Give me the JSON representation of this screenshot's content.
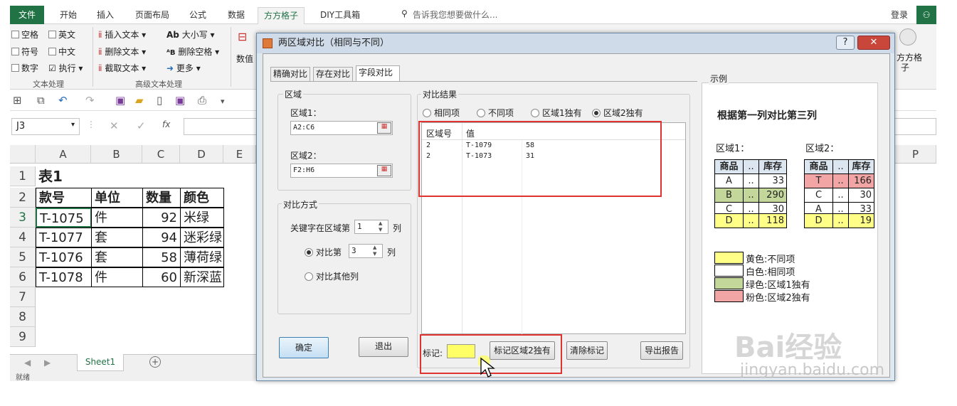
{
  "ribbon": {
    "tabs": [
      "文件",
      "开始",
      "插入",
      "页面布局",
      "公式",
      "数据",
      "方方格子",
      "DIY工具箱"
    ],
    "active_tab": "方方格子",
    "tell_me": "告诉我您想要做什么...",
    "login": "登录",
    "left_checks": [
      "空格",
      "英文",
      "符号",
      "中文",
      "数字"
    ],
    "exec": "执行",
    "text_tools": [
      "插入文本",
      "删除文本",
      "截取文本"
    ],
    "adv_tools": [
      "大小写",
      "删除空格",
      "更多"
    ],
    "group_text": "文本处理",
    "group_adv": "高级文本处理",
    "num_label": "数值",
    "fangge": "方方格",
    "zi": "子"
  },
  "formula": {
    "namebox": "J3",
    "fx": "fx"
  },
  "grid": {
    "columns": [
      "A",
      "B",
      "C",
      "D",
      "E"
    ],
    "col_p": "P",
    "rows": [
      "1",
      "2",
      "3",
      "4",
      "5",
      "6",
      "7",
      "8",
      "9"
    ],
    "title": "表1",
    "headers": [
      "款号",
      "单位",
      "数量",
      "颜色"
    ],
    "data": [
      [
        "T-1075",
        "件",
        "92",
        "米绿"
      ],
      [
        "T-1077",
        "套",
        "94",
        "迷彩绿"
      ],
      [
        "T-1076",
        "套",
        "58",
        "薄荷绿"
      ],
      [
        "T-1078",
        "件",
        "60",
        "新深蓝"
      ]
    ]
  },
  "sheet": {
    "tab": "Sheet1",
    "status": "就绪"
  },
  "dialog": {
    "title": "两区域对比（相同与不同）",
    "help": "?",
    "close": "✕",
    "tabs": [
      "精确对比",
      "存在对比",
      "字段对比"
    ],
    "active_tab": "字段对比",
    "area_group": "区域",
    "area1_label": "区域1：",
    "area1_value": "A2:C6",
    "area2_label": "区域2：",
    "area2_value": "F2:H6",
    "method_group": "对比方式",
    "key_label": "关键字在区域第",
    "key_value": "1",
    "col_unit": "列",
    "compare_label": "对比第",
    "compare_value": "3",
    "other_cols": "对比其他列",
    "ok": "确定",
    "exit": "退出",
    "result_group": "对比结果",
    "filters": [
      "相同项",
      "不同项",
      "区域1独有",
      "区域2独有"
    ],
    "selected_filter": "区域2独有",
    "result_headers": [
      "区域号",
      "值"
    ],
    "results": [
      [
        "2",
        "T-1079",
        "58"
      ],
      [
        "2",
        "T-1073",
        "31"
      ]
    ],
    "mark_label": "标记:",
    "mark_button": "标记区域2独有",
    "clear_button": "清除标记",
    "export_button": "导出报告",
    "example_group": "示例",
    "example_title": "根据第一列对比第三列",
    "ex_area1": "区域1：",
    "ex_area2": "区域2：",
    "ex_headers": [
      "商品",
      "..",
      "库存"
    ],
    "ex_table1": [
      [
        "A",
        "..",
        "33"
      ],
      [
        "B",
        "..",
        "290"
      ],
      [
        "C",
        "..",
        "30"
      ],
      [
        "D",
        "..",
        "118"
      ]
    ],
    "ex_table2": [
      [
        "T",
        "..",
        "166"
      ],
      [
        "C",
        "..",
        "30"
      ],
      [
        "A",
        "..",
        "33"
      ],
      [
        "D",
        "..",
        "19"
      ]
    ],
    "legend": [
      "黄色:不同项",
      "白色:相同项",
      "绿色:区域1独有",
      "粉色:区域2独有"
    ],
    "colors": {
      "yellow": "#ffff88",
      "white": "#ffffff",
      "green": "#c4d79b",
      "pink": "#f2a5a5",
      "header": "#dce6f1"
    }
  },
  "watermark": {
    "brand": "Bai经验",
    "url": "jingyan.baidu.com"
  }
}
